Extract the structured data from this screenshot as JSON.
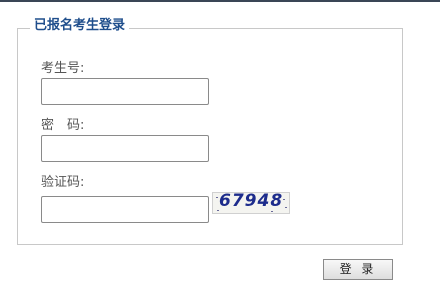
{
  "form": {
    "legend": "已报名考生登录",
    "exam_number_label": "考生号:",
    "exam_number_value": "",
    "password_label": "密　码:",
    "password_value": "",
    "captcha_label": "验证码:",
    "captcha_value": "",
    "captcha_image_text": "67948",
    "login_button": "登 录"
  },
  "colors": {
    "legend": "#1f4e8c",
    "captcha_text": "#1d2c8c"
  }
}
